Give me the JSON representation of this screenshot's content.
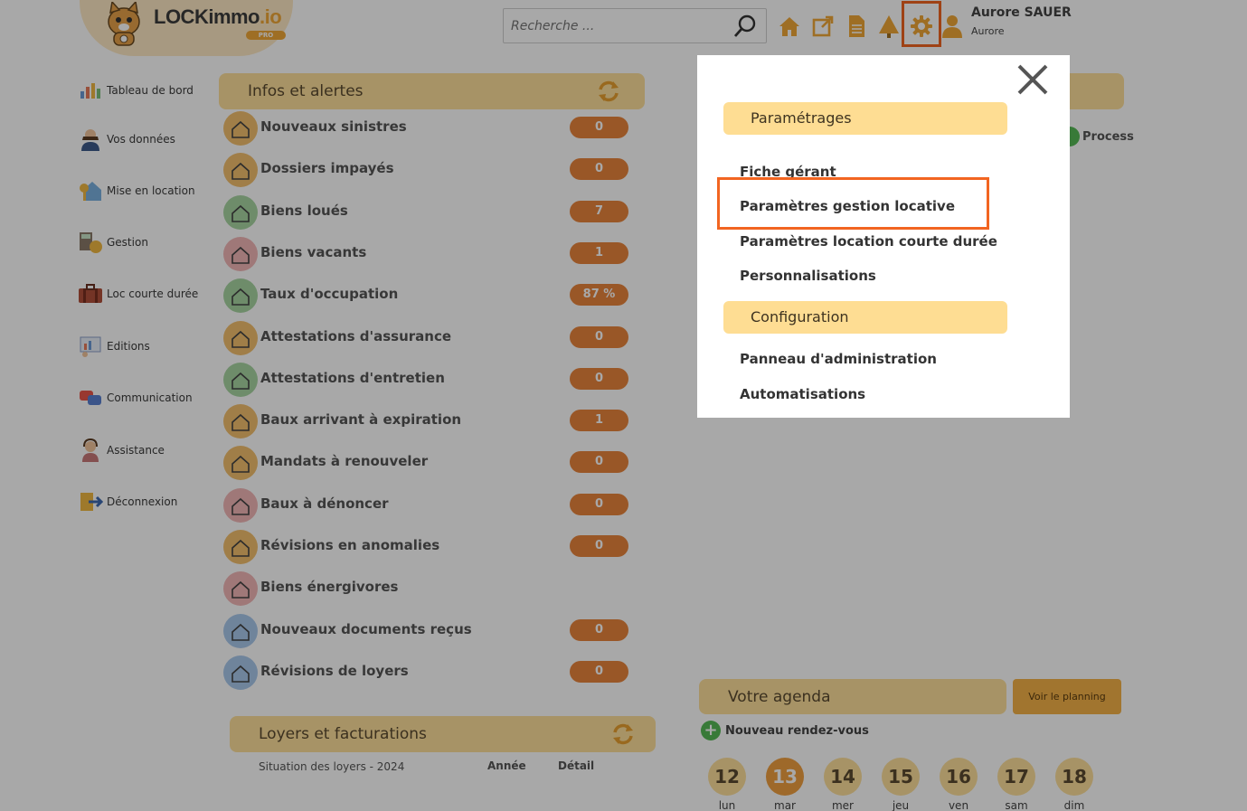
{
  "header": {
    "logo_text": "LOCKimmo",
    "logo_suffix": ".io",
    "logo_badge": "PRO",
    "search_placeholder": "Recherche ...",
    "user_name": "Aurore SAUER",
    "user_sub": "Aurore"
  },
  "sidebar": {
    "items": [
      {
        "label": "Tableau de bord",
        "icon": "chart-icon"
      },
      {
        "label": "Vos données",
        "icon": "person-icon"
      },
      {
        "label": "Mise en location",
        "icon": "house-key-icon"
      },
      {
        "label": "Gestion",
        "icon": "calculator-icon"
      },
      {
        "label": "Loc courte durée",
        "icon": "suitcase-icon"
      },
      {
        "label": "Editions",
        "icon": "report-icon"
      },
      {
        "label": "Communication",
        "icon": "chat-icon"
      },
      {
        "label": "Assistance",
        "icon": "support-agent-icon"
      },
      {
        "label": "Déconnexion",
        "icon": "logout-icon"
      }
    ]
  },
  "infos": {
    "title": "Infos et alertes",
    "rows": [
      {
        "label": "Nouveaux sinistres",
        "value": "0",
        "color": "#f3c06e"
      },
      {
        "label": "Dossiers impayés",
        "value": "0",
        "color": "#f3c06e"
      },
      {
        "label": "Biens loués",
        "value": "7",
        "color": "#a8d5a2"
      },
      {
        "label": "Biens vacants",
        "value": "1",
        "color": "#f1b6b6"
      },
      {
        "label": "Taux d'occupation",
        "value": "87 %",
        "color": "#a8d5a2"
      },
      {
        "label": "Attestations d'assurance",
        "value": "0",
        "color": "#f3c06e"
      },
      {
        "label": "Attestations d'entretien",
        "value": "0",
        "color": "#a8d5a2"
      },
      {
        "label": "Baux arrivant à expiration",
        "value": "1",
        "color": "#f3c06e"
      },
      {
        "label": "Mandats à renouveler",
        "value": "0",
        "color": "#f3c06e"
      },
      {
        "label": "Baux à dénoncer",
        "value": "0",
        "color": "#f1b6b6"
      },
      {
        "label": "Révisions en anomalies",
        "value": "0",
        "color": "#f3c06e"
      },
      {
        "label": "Biens énergivores",
        "value": "",
        "color": "#f1b6b6"
      },
      {
        "label": "Nouveaux documents reçus",
        "value": "0",
        "color": "#a9c8ec"
      },
      {
        "label": "Révisions de loyers",
        "value": "0",
        "color": "#a9c8ec"
      }
    ]
  },
  "loyers": {
    "title": "Loyers et facturations",
    "situation": "Situation des loyers - 2024",
    "col_annee": "Année",
    "col_detail": "Détail"
  },
  "right": {
    "process": "Process",
    "agenda_title": "Votre agenda",
    "planning_btn": "Voir le planning",
    "new_rdv": "Nouveau rendez-vous",
    "days": [
      {
        "num": "12",
        "name": "lun"
      },
      {
        "num": "13",
        "name": "mar"
      },
      {
        "num": "14",
        "name": "mer"
      },
      {
        "num": "15",
        "name": "jeu"
      },
      {
        "num": "16",
        "name": "ven"
      },
      {
        "num": "17",
        "name": "sam"
      },
      {
        "num": "18",
        "name": "dim"
      }
    ]
  },
  "modal": {
    "section1": "Paramétrages",
    "items1": [
      "Fiche gérant",
      "Paramètres gestion locative",
      "Paramètres location courte durée",
      "Personnalisations"
    ],
    "section2": "Configuration",
    "items2": [
      "Panneau d'administration",
      "Automatisations"
    ]
  }
}
